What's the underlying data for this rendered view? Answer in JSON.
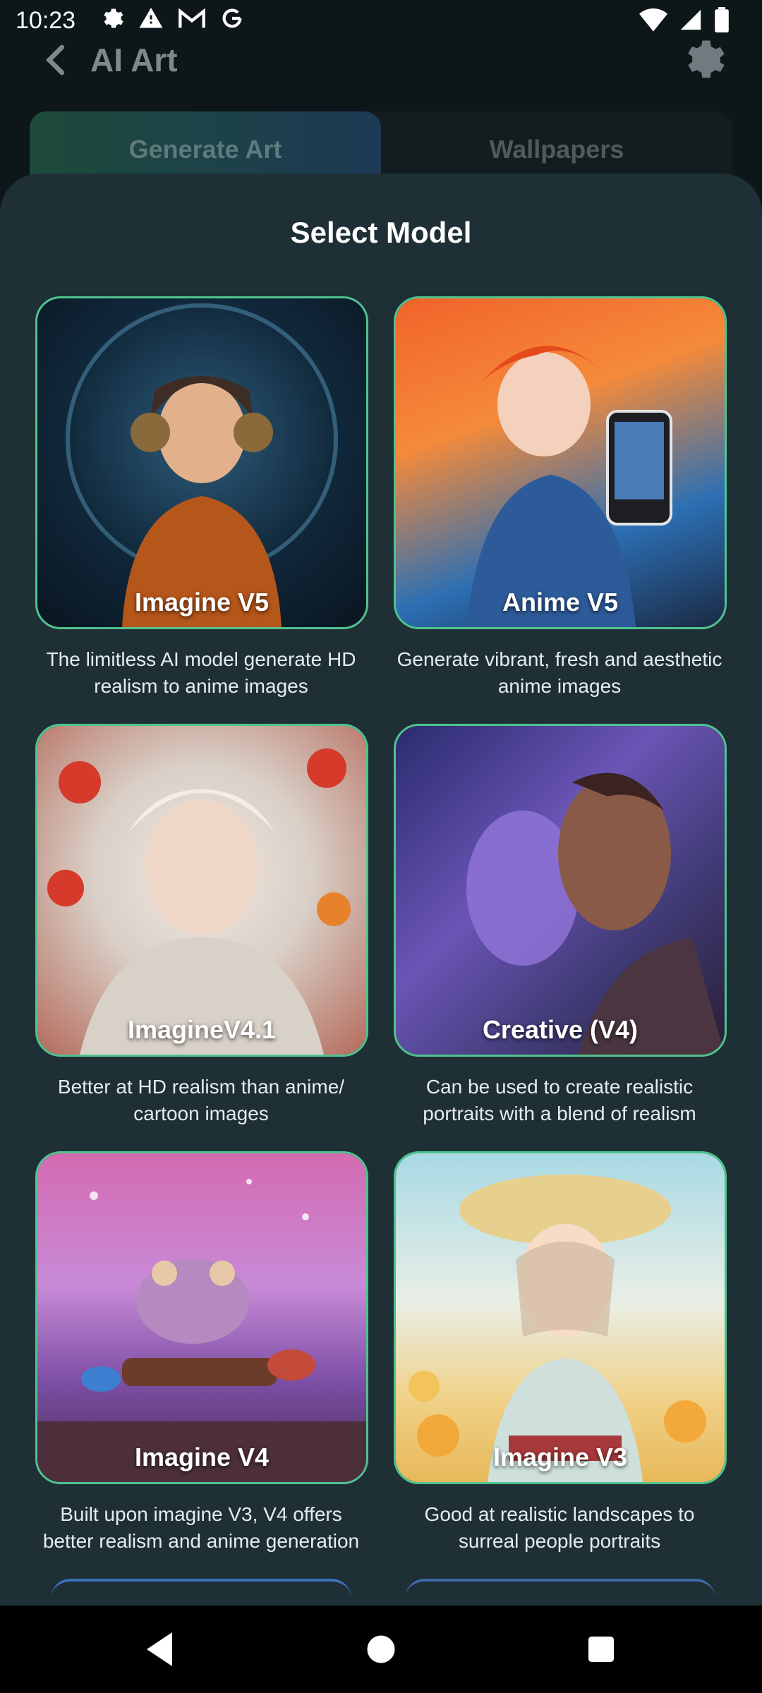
{
  "status_bar": {
    "time": "10:23"
  },
  "app_bar": {
    "title": "AI Art"
  },
  "tabs": [
    {
      "label": "Generate Art",
      "active": true
    },
    {
      "label": "Wallpapers",
      "active": false
    }
  ],
  "sheet": {
    "title": "Select Model",
    "models": [
      {
        "name": "Imagine V5",
        "description": "The limitless AI model generate HD realism to anime images"
      },
      {
        "name": "Anime V5",
        "description": "Generate vibrant, fresh and aesthetic anime images"
      },
      {
        "name": "ImagineV4.1",
        "description": "Better at HD realism than anime/ cartoon images"
      },
      {
        "name": "Creative (V4)",
        "description": "Can be used to create realistic portraits with a blend of realism"
      },
      {
        "name": "Imagine V4",
        "description": "Built upon imagine V3, V4 offers better realism and anime generation"
      },
      {
        "name": "Imagine V3",
        "description": "Good at realistic landscapes to surreal people portraits"
      }
    ]
  },
  "colors": {
    "card_border": "#4fc38f",
    "sheet_bg": "#1e2f35",
    "screen_bg": "#0d1619"
  },
  "icons": {
    "status_left": [
      "settings-icon",
      "alert-icon",
      "gmail-icon",
      "google-icon"
    ],
    "status_right": [
      "wifi-icon",
      "signal-icon",
      "battery-icon"
    ],
    "app_bar": [
      "back-icon",
      "gear-icon"
    ],
    "nav": [
      "back-triangle-icon",
      "home-circle-icon",
      "recents-square-icon"
    ]
  }
}
